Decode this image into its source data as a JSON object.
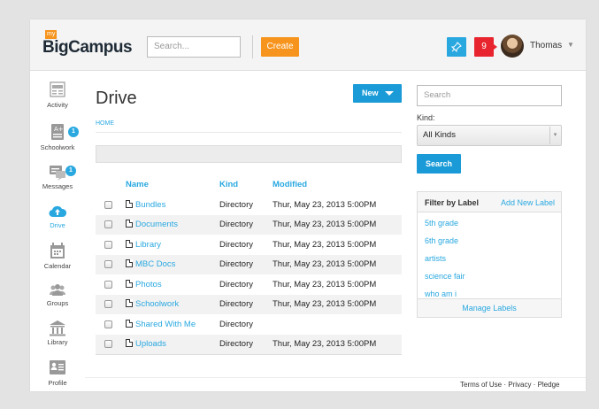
{
  "header": {
    "logo_badge": "my",
    "logo_text": "BigCampus",
    "search_placeholder": "Search...",
    "create_label": "Create",
    "notification_count": "9",
    "user_name": "Thomas",
    "user_caret": "▼"
  },
  "sidebar": {
    "items": [
      {
        "label": "Activity",
        "icon": "activity-icon"
      },
      {
        "label": "Schoolwork",
        "icon": "schoolwork-icon",
        "badge": "1"
      },
      {
        "label": "Messages",
        "icon": "messages-icon",
        "badge": "1"
      },
      {
        "label": "Drive",
        "icon": "cloud-upload-icon",
        "active": true
      },
      {
        "label": "Calendar",
        "icon": "calendar-icon"
      },
      {
        "label": "Groups",
        "icon": "groups-icon"
      },
      {
        "label": "Library",
        "icon": "library-icon"
      },
      {
        "label": "Profile",
        "icon": "profile-icon"
      }
    ]
  },
  "main": {
    "title": "Drive",
    "new_label": "New",
    "breadcrumb": "HOME",
    "columns": {
      "name": "Name",
      "kind": "Kind",
      "modified": "Modified"
    },
    "rows": [
      {
        "name": "Bundles",
        "kind": "Directory",
        "modified": "Thur, May 23, 2013 5:00PM"
      },
      {
        "name": "Documents",
        "kind": "Directory",
        "modified": "Thur, May 23, 2013 5:00PM"
      },
      {
        "name": "Library",
        "kind": "Directory",
        "modified": "Thur, May 23, 2013 5:00PM"
      },
      {
        "name": "MBC Docs",
        "kind": "Directory",
        "modified": "Thur, May 23, 2013 5:00PM"
      },
      {
        "name": "Photos",
        "kind": "Directory",
        "modified": "Thur, May 23, 2013 5:00PM"
      },
      {
        "name": "Schoolwork",
        "kind": "Directory",
        "modified": "Thur, May 23, 2013 5:00PM"
      },
      {
        "name": "Shared With Me",
        "kind": "Directory",
        "modified": ""
      },
      {
        "name": "Uploads",
        "kind": "Directory",
        "modified": "Thur, May 23, 2013 5:00PM"
      }
    ]
  },
  "right": {
    "search_placeholder": "Search",
    "kind_label": "Kind:",
    "kind_value": "All Kinds",
    "search_button": "Search",
    "filter_title": "Filter by Label",
    "add_label": "Add New Label",
    "labels": [
      "5th grade",
      "6th grade",
      "artists",
      "science fair",
      "who am i"
    ],
    "manage_labels": "Manage Labels"
  },
  "footer": {
    "text": "Terms of Use · Privacy · Pledge"
  },
  "colors": {
    "accent": "#29a8e0",
    "button_blue": "#1a9bd7",
    "create_orange": "#f7941d",
    "notification_red": "#e8252e"
  }
}
